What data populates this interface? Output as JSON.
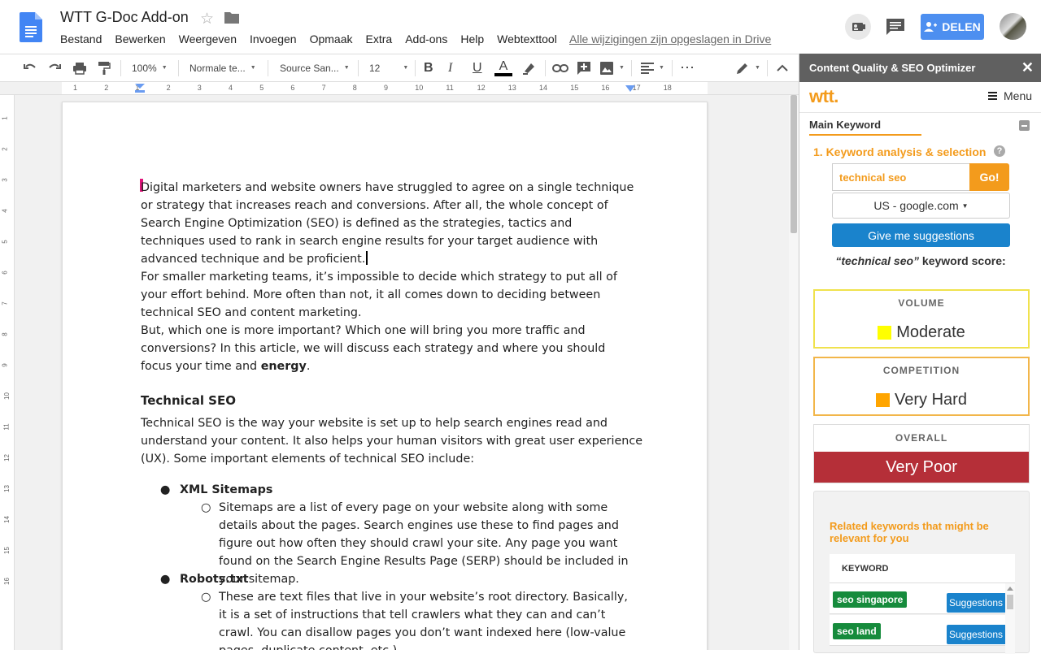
{
  "header": {
    "title": "WTT G-Doc Add-on",
    "menu": [
      "Bestand",
      "Bewerken",
      "Weergeven",
      "Invoegen",
      "Opmaak",
      "Extra",
      "Add-ons",
      "Help",
      "Webtexttool"
    ],
    "saved_status": "Alle wijzigingen zijn opgeslagen in Drive",
    "share_label": "DELEN"
  },
  "toolbar": {
    "zoom": "100%",
    "style": "Normale te...",
    "font": "Source San...",
    "size": "12",
    "bold": "B",
    "italic": "I",
    "underline": "U",
    "text_color": "A"
  },
  "ruler": {
    "marks": [
      "1",
      "2",
      "1",
      "2",
      "3",
      "4",
      "5",
      "6",
      "7",
      "8",
      "9",
      "10",
      "11",
      "12",
      "13",
      "14",
      "15",
      "16",
      "17",
      "18"
    ]
  },
  "vruler": {
    "marks": [
      "1",
      "2",
      "3",
      "4",
      "5",
      "6",
      "7",
      "8",
      "9",
      "10",
      "11",
      "12",
      "13",
      "14",
      "15",
      "16"
    ]
  },
  "document": {
    "p1": "Digital marketers and website owners have struggled to agree on a single technique or strategy that increases reach and conversions. After all, the whole concept of Search Engine Optimization (SEO) is defined as the strategies, tactics and techniques used to rank in search engine results for your target audience with advanced technique and be proficient.",
    "p2": "For smaller marketing teams, it’s impossible to decide which strategy to put all of your effort behind. More often than not, it all comes down to deciding between technical SEO and content marketing.",
    "p3_lead": "But, which one is more important? Which one will bring you more traffic and conversions? In this article, we will discuss each strategy and where you should focus your time and ",
    "p3_bold": "energy",
    "p3_end": ".",
    "h_technical": "Technical SEO",
    "p4": "Technical SEO is the way your website is set up to help search engines read and understand your content. It also helps your human visitors with great user experience (UX). Some important elements of technical SEO include:",
    "bullet1": "XML Sitemaps",
    "bullet1_sub": "Sitemaps are a list of every page on your website along with some details about the pages. Search engines use these to find pages and figure out how often they should crawl your site. Any page you want found on the Search Engine Results Page (SERP) should be included in your sitemap.",
    "bullet2": "Robots.txt",
    "bullet2_sub": "These are text files that live in your website’s root directory. Basically, it is a set of instructions that tell crawlers what they can and can’t crawl. You can disallow pages you don’t want indexed here (low-value pages, duplicate content, etc.)"
  },
  "panel": {
    "title": "Content Quality & SEO Optimizer",
    "close": "✕",
    "logo": "wtt.",
    "menu_label": "Menu",
    "tab": "Main Keyword",
    "section_title": "1. Keyword analysis & selection",
    "help": "?",
    "keyword_value": "technical seo",
    "go_label": "Go!",
    "region": "US - google.com",
    "suggest_label": "Give me suggestions",
    "score_keyword": "“technical seo”",
    "score_suffix": " keyword score:",
    "volume_label": "VOLUME",
    "volume_value": "Moderate",
    "volume_color": "#ffff00",
    "competition_label": "COMPETITION",
    "competition_value": "Very Hard",
    "competition_color": "#ffa500",
    "overall_label": "OVERALL",
    "overall_value": "Very Poor",
    "overall_color": "#b52f38",
    "related_title": "Related keywords that might be relevant for you",
    "kw_header": "KEYWORD",
    "related": [
      {
        "keyword": "seo singapore",
        "action": "Suggestions"
      },
      {
        "keyword": "seo land",
        "action": "Suggestions"
      }
    ]
  }
}
